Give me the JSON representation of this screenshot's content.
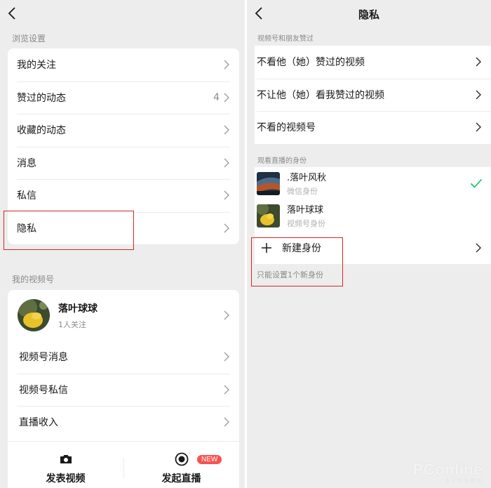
{
  "left": {
    "back_icon": "chevron-left-icon",
    "browse_section": "浏览设置",
    "browse_items": [
      {
        "label": "我的关注",
        "badge": ""
      },
      {
        "label": "赞过的动态",
        "badge": "4"
      },
      {
        "label": "收藏的动态",
        "badge": ""
      },
      {
        "label": "消息",
        "badge": ""
      },
      {
        "label": "私信",
        "badge": ""
      },
      {
        "label": "隐私",
        "badge": ""
      }
    ],
    "channel_section": "我的视频号",
    "profile": {
      "name": "落叶球球",
      "followers": "1人关注"
    },
    "channel_items": [
      {
        "label": "视频号消息"
      },
      {
        "label": "视频号私信"
      },
      {
        "label": "直播收入"
      }
    ],
    "actions": [
      {
        "label": "发表视频",
        "icon": "camera-icon"
      },
      {
        "label": "发起直播",
        "icon": "record-icon",
        "badge": "NEW"
      }
    ]
  },
  "right": {
    "title": "隐私",
    "likes_section": "视频号和朋友赞过",
    "likes_items": [
      {
        "label": "不看他（她）赞过的视频"
      },
      {
        "label": "不让他（她）看我赞过的视频"
      },
      {
        "label": "不看的视频号"
      }
    ],
    "identity_section": "观看直播的身份",
    "identities": [
      {
        "name": ".落叶风秋",
        "type": "微信身份",
        "selected": true
      },
      {
        "name": "落叶球球",
        "type": "视频号身份",
        "selected": false
      }
    ],
    "new_identity": "新建身份",
    "hint": "只能设置1个新身份"
  },
  "watermark": {
    "brand": "PConline",
    "sub": "太平洋电脑网"
  },
  "colors": {
    "highlight_box": "#d52626",
    "check": "#07c160",
    "badge": "#fa5151"
  }
}
